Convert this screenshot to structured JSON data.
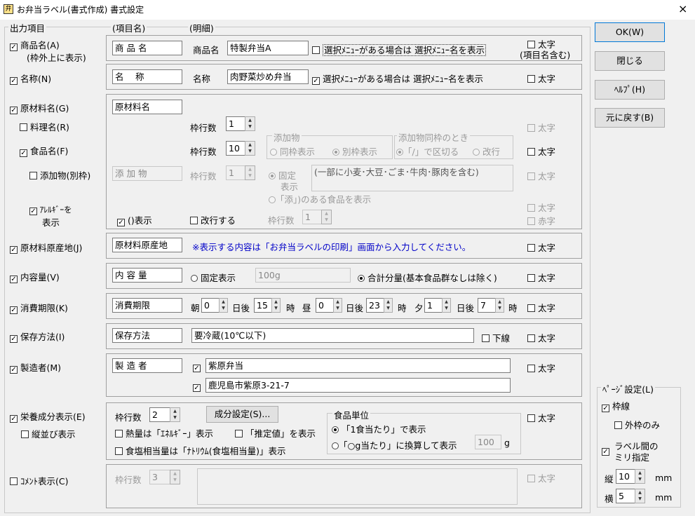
{
  "window": {
    "title": "お弁当ラベル(書式作成) 書式設定",
    "close": "×"
  },
  "headers": {
    "output": "出力項目",
    "item_name": "(項目名)",
    "desc": "(明細)"
  },
  "rows": {
    "shohin": {
      "label": "商品名(A)",
      "sub": "(枠外上に表示)",
      "item": "商 品 名",
      "name_label": "商品名",
      "value": "特製弁当A",
      "menu_cb": "選択ﾒﾆｭｰがある場合は 選択ﾒﾆｭｰ名を表示",
      "bold": "太字",
      "bold_sub": "(項目名含む)"
    },
    "meisho": {
      "label": "名称(N)",
      "item": "名　 称",
      "name_label": "名称",
      "value": "肉野菜炒め弁当",
      "menu_cb": "選択ﾒﾆｭｰがある場合は 選択ﾒﾆｭｰ名を表示",
      "bold": "太字"
    },
    "genzai": {
      "label": "原材料名(G)",
      "item": "原材料名",
      "ryori": "料理名(R)",
      "shokuhin": "食品名(F)",
      "tenka": "添加物(別枠)",
      "tenka_item": "添 加 物",
      "allergy": "ｱﾚﾙｷﾞｰを",
      "allergy2": "表示",
      "waku": "枠行数",
      "waku_ryori": "1",
      "waku_shokuhin": "10",
      "waku_tenka": "1",
      "waku_allergy": "1",
      "tenka_group": "添加物",
      "tenka_same": "同枠表示",
      "tenka_sep": "別枠表示",
      "same_group": "添加物同枠のとき",
      "slash": "「/」で区切る",
      "kaigyo": "改行",
      "kotei": "固定",
      "kotei2": "表示",
      "allergy_text": "(一部に小麦･大豆･ごま･牛肉･豚肉を含む)",
      "soe": "「添」)のある食品を表示",
      "paren": "()表示",
      "kaigyo_suru": "改行する",
      "bold": "太字",
      "red": "赤字"
    },
    "gensan": {
      "label": "原材料原産地(J)",
      "item": "原材料原産地",
      "note": "※表示する内容は「お弁当ラベルの印刷」画面から入力してください。",
      "bold": "太字"
    },
    "naiyo": {
      "label": "内容量(V)",
      "item": "内 容 量",
      "fixed": "固定表示",
      "fixed_val": "100g",
      "total": "合計分量(基本食品群なしは除く)",
      "bold": "太字"
    },
    "shohi": {
      "label": "消費期限(K)",
      "item": "消費期限",
      "asa": "朝",
      "asa_v": "0",
      "hiru": "昼",
      "hiru_v": "0",
      "yu": "夕",
      "yu_v": "1",
      "nichigo": "日後",
      "asa_h": "15",
      "hiru_h": "23",
      "yu_h": "7",
      "ji": "時",
      "bold": "太字"
    },
    "hozon": {
      "label": "保存方法(I)",
      "item": "保存方法",
      "value": "要冷蔵(10℃以下)",
      "underline": "下線",
      "bold": "太字"
    },
    "seizo": {
      "label": "製造者(M)",
      "item": "製 造 者",
      "name": "紫原弁当",
      "addr": "鹿児島市紫原3-21-7",
      "bold": "太字"
    },
    "eiyo": {
      "label": "栄養成分表示(E)",
      "tate": "縦並び表示",
      "waku": "枠行数",
      "waku_v": "2",
      "btn": "成分設定(S)...",
      "netsu": "熱量は「ｴﾈﾙｷﾞｰ」表示",
      "suitei": "「推定値」を表示",
      "shoku": "食塩相当量は「ﾅﾄﾘｳﾑ(食塩相当量)」表示",
      "unit_group": "食品単位",
      "per1": "「1食当たり」で表示",
      "perg": "「○g当たり」に換算して表示",
      "g_val": "100",
      "g": "g",
      "bold": "太字"
    },
    "comment": {
      "label": "ｺﾒﾝﾄ表示(C)",
      "waku": "枠行数",
      "waku_v": "3",
      "bold": "太字"
    }
  },
  "buttons": {
    "ok": "OK(W)",
    "close": "閉じる",
    "help": "ﾍﾙﾌﾟ(H)",
    "reset": "元に戻す(B)"
  },
  "page": {
    "group": "ﾍﾟｰｼﾞ設定(L)",
    "wakusen": "枠線",
    "sotowaku": "外枠のみ",
    "label_mm": "ラベル間の",
    "label_mm2": "ミリ指定",
    "tate": "縦",
    "tate_v": "10",
    "yoko": "横",
    "yoko_v": "5",
    "mm": "mm"
  }
}
